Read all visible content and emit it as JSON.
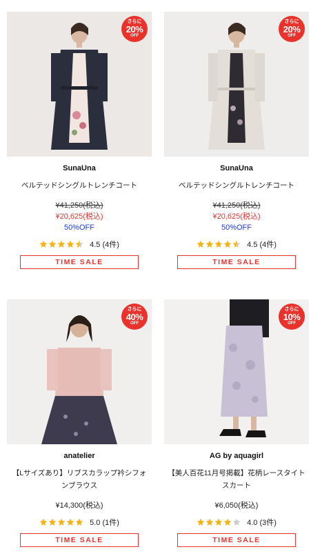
{
  "products": [
    {
      "badge": {
        "pre": "さらに",
        "pct": "20%",
        "off": "OFF"
      },
      "brand": "SunaUna",
      "name": "ベルテッドシングルトレンチコート",
      "price_old": "¥41,250(税込)",
      "price_sale": "¥20,625(税込)",
      "discount": "50%OFF",
      "rating": 4.5,
      "rating_text": "4.5 (4件)",
      "button_label": "TIME SALE"
    },
    {
      "badge": {
        "pre": "さらに",
        "pct": "20%",
        "off": "OFF"
      },
      "brand": "SunaUna",
      "name": "ベルテッドシングルトレンチコート",
      "price_old": "¥41,250(税込)",
      "price_sale": "¥20,625(税込)",
      "discount": "50%OFF",
      "rating": 4.5,
      "rating_text": "4.5 (4件)",
      "button_label": "TIME SALE"
    },
    {
      "badge": {
        "pre": "さらに",
        "pct": "40%",
        "off": "OFF"
      },
      "brand": "anatelier",
      "name": "【Lサイズあり】リブスカラップ衿シフォンブラウス",
      "price": "¥14,300(税込)",
      "rating": 5.0,
      "rating_text": "5.0 (1件)",
      "button_label": "TIME SALE"
    },
    {
      "badge": {
        "pre": "さらに",
        "pct": "10%",
        "off": "OFF"
      },
      "brand": "AG by aquagirl",
      "name": "【美人百花11月号掲載】花柄レースタイトスカート",
      "price": "¥6,050(税込)",
      "rating": 4.0,
      "rating_text": "4.0 (3件)",
      "button_label": "TIME SALE"
    }
  ],
  "colors": {
    "accent_red": "#e8322b",
    "discount_blue": "#1f3bd6",
    "star_gold": "#f2b418",
    "star_empty": "#cccccc"
  }
}
